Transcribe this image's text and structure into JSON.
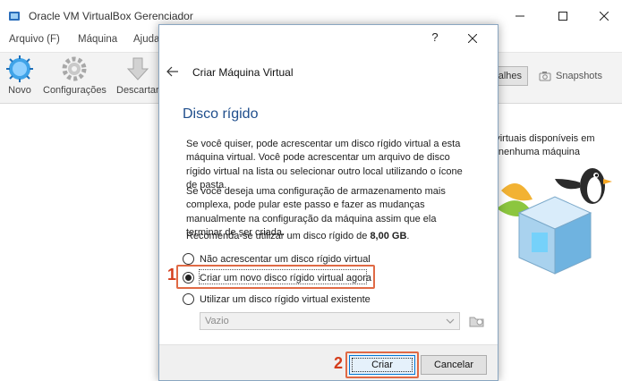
{
  "main_window": {
    "title": "Oracle VM VirtualBox Gerenciador",
    "menu": [
      "Arquivo (F)",
      "Máquina",
      "Ajuda"
    ],
    "toolbar": {
      "new_label": "Novo",
      "settings_label": "Configurações",
      "discard_label": "Descartar"
    },
    "tabs": {
      "details_label": "Detalhes",
      "details_visible": "talhes",
      "snapshots_label": "Snapshots"
    },
    "welcome_lines": [
      "inas virtuais disponíveis em",
      "criou nenhuma máquina"
    ]
  },
  "dialog": {
    "help_label": "?",
    "wizard_title": "Criar Máquina Virtual",
    "page_title": "Disco rígido",
    "paragraph_1": "Se você quiser, pode acrescentar um disco rígido virtual a esta máquina virtual. Você pode acrescentar um arquivo de disco rígido virtual na lista ou selecionar outro local utilizando o ícone de pasta.",
    "paragraph_2": "Se você deseja uma configuração de armazenamento mais complexa, pode pular este passo e fazer as mudanças manualmente na configuração da máquina assim que ela terminar de ser criada.",
    "recommend_prefix": "Recomenda-se utilizar um disco rígido de ",
    "recommend_size": "8,00 GB",
    "recommend_suffix": ".",
    "options": {
      "none": "Não acrescentar um disco rígido virtual",
      "create": "Criar um novo disco rígido virtual agora",
      "existing": "Utilizar um disco rígido virtual existente"
    },
    "selected_option": "create",
    "disk_select_value": "Vazio",
    "buttons": {
      "create": "Criar",
      "cancel": "Cancelar"
    },
    "step_markers": [
      "1",
      "2"
    ]
  },
  "colors": {
    "accent_blue": "#1f4e8c",
    "highlight_orange": "#e06a45",
    "marker_red": "#d43c1a",
    "focus_blue": "#0078d7"
  }
}
